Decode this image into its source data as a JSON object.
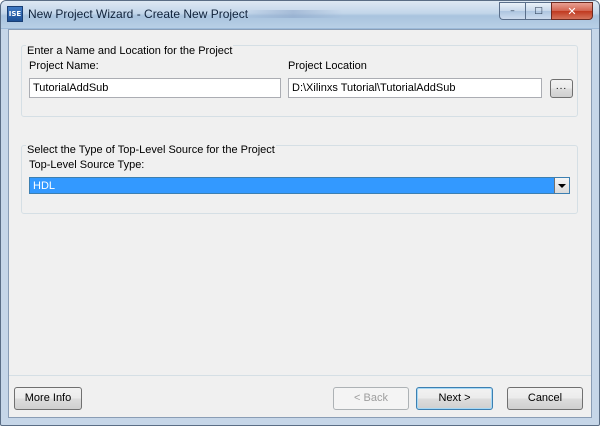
{
  "window": {
    "title": "New Project Wizard - Create New Project",
    "app_icon_text": "ISE",
    "controls": {
      "minimize": "–",
      "maximize": "□",
      "close": "✕"
    }
  },
  "name_location_group": {
    "title": "Enter a Name and Location for the Project",
    "project_name_label": "Project Name:",
    "project_name_value": "TutorialAddSub",
    "project_location_label": "Project Location",
    "project_location_value": "D:\\Xilinxs Tutorial\\TutorialAddSub",
    "browse_label": "..."
  },
  "source_type_group": {
    "title": "Select the Type of Top-Level Source for the Project",
    "source_type_label": "Top-Level Source Type:",
    "source_type_value": "HDL"
  },
  "footer": {
    "more_info_label": "More Info",
    "back_label": "< Back",
    "next_label": "Next >",
    "cancel_label": "Cancel"
  },
  "colors": {
    "selection": "#3399ff",
    "titlebar": "#b9d1ea",
    "dialog_bg": "#f0f0f0"
  }
}
